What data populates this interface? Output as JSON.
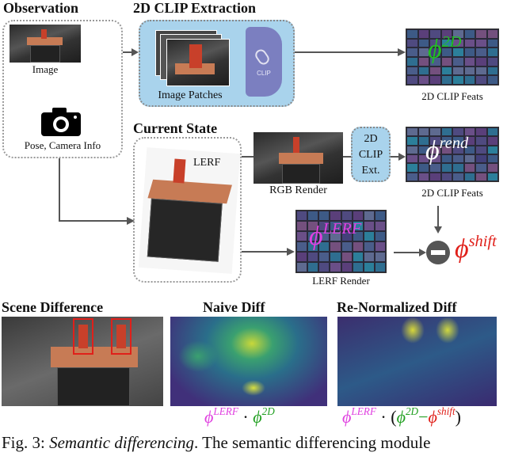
{
  "observation": {
    "title": "Observation",
    "image_label": "Image",
    "pose_label": "Pose, Camera Info"
  },
  "extraction": {
    "title": "2D CLIP Extraction",
    "patches_label": "Image Patches",
    "clip_label": "CLIP"
  },
  "feats_top": {
    "label": "2D CLIP Feats",
    "symbol": "ϕ",
    "sup": "2D",
    "color": "#22c022"
  },
  "current_state": {
    "title": "Current State",
    "lerf_label": "LERF"
  },
  "rgb_render": {
    "label": "RGB Render"
  },
  "clip_ext": {
    "line1": "2D",
    "line2": "CLIP",
    "line3": "Ext."
  },
  "feats_rend": {
    "label": "2D CLIP Feats",
    "symbol": "ϕ",
    "sup": "rend",
    "color": "#ffffff"
  },
  "lerf_render": {
    "label": "LERF Render",
    "symbol": "ϕ",
    "sup": "LERF",
    "color": "#e040e0"
  },
  "shift": {
    "symbol": "ϕ",
    "sup": "shift",
    "color": "#e0201a"
  },
  "bottom": {
    "scene_diff": "Scene Difference",
    "naive_diff": "Naive Diff",
    "renorm_diff": "Re-Normalized Diff",
    "naive_formula": {
      "a": "ϕ",
      "a_sup": "LERF",
      "dot": " · ",
      "b": "ϕ",
      "b_sup": "2D"
    },
    "renorm_formula": {
      "a": "ϕ",
      "a_sup": "LERF",
      "dot": " · (",
      "b": "ϕ",
      "b_sup": "2D",
      "minus": "−",
      "c": "ϕ",
      "c_sup": "shift",
      "close": ")"
    }
  },
  "caption": {
    "prefix": "Fig. 3: ",
    "emph": "Semantic differencing",
    "rest": ". The semantic differencing module"
  },
  "colors": {
    "clip_box": "#a9d3ec",
    "clip_shape": "#7b7fc0",
    "lerf_magenta": "#e040e0",
    "green": "#22a022",
    "red": "#e0201a"
  }
}
